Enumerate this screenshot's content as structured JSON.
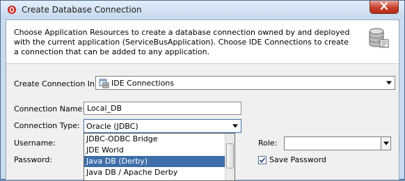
{
  "window": {
    "title": "Create Database Connection"
  },
  "header": {
    "description": "Choose Application Resources to create a database connection owned by and deployed with the current application (ServiceBusApplication). Choose IDE Connections to create a connection that can be added to any application."
  },
  "form": {
    "create_in_label": "Create Connection In:",
    "create_in_value": "IDE Connections",
    "name_label": "Connection Name:",
    "name_value": "Local_DB",
    "type_label": "Connection Type:",
    "type_value": "Oracle (JDBC)",
    "username_label": "Username:",
    "password_label": "Password:",
    "role_label": "Role:",
    "role_value": "",
    "save_password_label": "Save Password",
    "save_password_checked": true
  },
  "type_dropdown": {
    "options": [
      "JDBC-ODBC Bridge",
      "JDE World",
      "Java DB (Derby)",
      "Java DB / Apache Derby"
    ],
    "highlighted_index": 2
  },
  "icons": {
    "title": "oracle-logo-icon",
    "header": "database-connection-icon",
    "create_in": "ide-connections-icon"
  }
}
